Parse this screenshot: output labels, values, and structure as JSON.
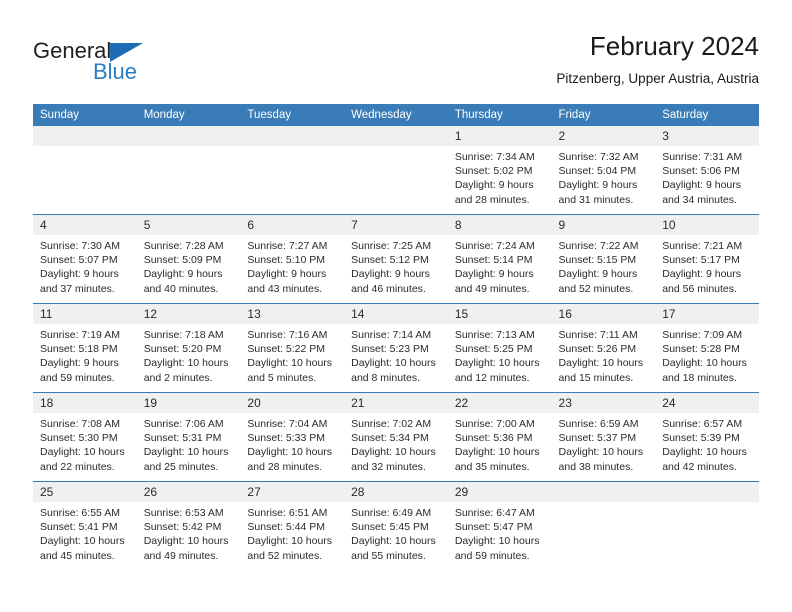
{
  "brand": {
    "line1": "General",
    "line2": "Blue",
    "triangle_color": "#1e6cb5",
    "blue_color": "#2b7dc4"
  },
  "header": {
    "title": "February 2024",
    "location": "Pitzenberg, Upper Austria, Austria"
  },
  "colors": {
    "header_blue": "#3a7cb8",
    "daynum_band": "#f0f0f0",
    "text": "#2b2b2b"
  },
  "weekday_headers": [
    "Sunday",
    "Monday",
    "Tuesday",
    "Wednesday",
    "Thursday",
    "Friday",
    "Saturday"
  ],
  "weeks": [
    [
      {
        "day": "",
        "empty": true
      },
      {
        "day": "",
        "empty": true
      },
      {
        "day": "",
        "empty": true
      },
      {
        "day": "",
        "empty": true
      },
      {
        "day": "1",
        "sunrise": "Sunrise: 7:34 AM",
        "sunset": "Sunset: 5:02 PM",
        "daylight1": "Daylight: 9 hours",
        "daylight2": "and 28 minutes."
      },
      {
        "day": "2",
        "sunrise": "Sunrise: 7:32 AM",
        "sunset": "Sunset: 5:04 PM",
        "daylight1": "Daylight: 9 hours",
        "daylight2": "and 31 minutes."
      },
      {
        "day": "3",
        "sunrise": "Sunrise: 7:31 AM",
        "sunset": "Sunset: 5:06 PM",
        "daylight1": "Daylight: 9 hours",
        "daylight2": "and 34 minutes."
      }
    ],
    [
      {
        "day": "4",
        "sunrise": "Sunrise: 7:30 AM",
        "sunset": "Sunset: 5:07 PM",
        "daylight1": "Daylight: 9 hours",
        "daylight2": "and 37 minutes."
      },
      {
        "day": "5",
        "sunrise": "Sunrise: 7:28 AM",
        "sunset": "Sunset: 5:09 PM",
        "daylight1": "Daylight: 9 hours",
        "daylight2": "and 40 minutes."
      },
      {
        "day": "6",
        "sunrise": "Sunrise: 7:27 AM",
        "sunset": "Sunset: 5:10 PM",
        "daylight1": "Daylight: 9 hours",
        "daylight2": "and 43 minutes."
      },
      {
        "day": "7",
        "sunrise": "Sunrise: 7:25 AM",
        "sunset": "Sunset: 5:12 PM",
        "daylight1": "Daylight: 9 hours",
        "daylight2": "and 46 minutes."
      },
      {
        "day": "8",
        "sunrise": "Sunrise: 7:24 AM",
        "sunset": "Sunset: 5:14 PM",
        "daylight1": "Daylight: 9 hours",
        "daylight2": "and 49 minutes."
      },
      {
        "day": "9",
        "sunrise": "Sunrise: 7:22 AM",
        "sunset": "Sunset: 5:15 PM",
        "daylight1": "Daylight: 9 hours",
        "daylight2": "and 52 minutes."
      },
      {
        "day": "10",
        "sunrise": "Sunrise: 7:21 AM",
        "sunset": "Sunset: 5:17 PM",
        "daylight1": "Daylight: 9 hours",
        "daylight2": "and 56 minutes."
      }
    ],
    [
      {
        "day": "11",
        "sunrise": "Sunrise: 7:19 AM",
        "sunset": "Sunset: 5:18 PM",
        "daylight1": "Daylight: 9 hours",
        "daylight2": "and 59 minutes."
      },
      {
        "day": "12",
        "sunrise": "Sunrise: 7:18 AM",
        "sunset": "Sunset: 5:20 PM",
        "daylight1": "Daylight: 10 hours",
        "daylight2": "and 2 minutes."
      },
      {
        "day": "13",
        "sunrise": "Sunrise: 7:16 AM",
        "sunset": "Sunset: 5:22 PM",
        "daylight1": "Daylight: 10 hours",
        "daylight2": "and 5 minutes."
      },
      {
        "day": "14",
        "sunrise": "Sunrise: 7:14 AM",
        "sunset": "Sunset: 5:23 PM",
        "daylight1": "Daylight: 10 hours",
        "daylight2": "and 8 minutes."
      },
      {
        "day": "15",
        "sunrise": "Sunrise: 7:13 AM",
        "sunset": "Sunset: 5:25 PM",
        "daylight1": "Daylight: 10 hours",
        "daylight2": "and 12 minutes."
      },
      {
        "day": "16",
        "sunrise": "Sunrise: 7:11 AM",
        "sunset": "Sunset: 5:26 PM",
        "daylight1": "Daylight: 10 hours",
        "daylight2": "and 15 minutes."
      },
      {
        "day": "17",
        "sunrise": "Sunrise: 7:09 AM",
        "sunset": "Sunset: 5:28 PM",
        "daylight1": "Daylight: 10 hours",
        "daylight2": "and 18 minutes."
      }
    ],
    [
      {
        "day": "18",
        "sunrise": "Sunrise: 7:08 AM",
        "sunset": "Sunset: 5:30 PM",
        "daylight1": "Daylight: 10 hours",
        "daylight2": "and 22 minutes."
      },
      {
        "day": "19",
        "sunrise": "Sunrise: 7:06 AM",
        "sunset": "Sunset: 5:31 PM",
        "daylight1": "Daylight: 10 hours",
        "daylight2": "and 25 minutes."
      },
      {
        "day": "20",
        "sunrise": "Sunrise: 7:04 AM",
        "sunset": "Sunset: 5:33 PM",
        "daylight1": "Daylight: 10 hours",
        "daylight2": "and 28 minutes."
      },
      {
        "day": "21",
        "sunrise": "Sunrise: 7:02 AM",
        "sunset": "Sunset: 5:34 PM",
        "daylight1": "Daylight: 10 hours",
        "daylight2": "and 32 minutes."
      },
      {
        "day": "22",
        "sunrise": "Sunrise: 7:00 AM",
        "sunset": "Sunset: 5:36 PM",
        "daylight1": "Daylight: 10 hours",
        "daylight2": "and 35 minutes."
      },
      {
        "day": "23",
        "sunrise": "Sunrise: 6:59 AM",
        "sunset": "Sunset: 5:37 PM",
        "daylight1": "Daylight: 10 hours",
        "daylight2": "and 38 minutes."
      },
      {
        "day": "24",
        "sunrise": "Sunrise: 6:57 AM",
        "sunset": "Sunset: 5:39 PM",
        "daylight1": "Daylight: 10 hours",
        "daylight2": "and 42 minutes."
      }
    ],
    [
      {
        "day": "25",
        "sunrise": "Sunrise: 6:55 AM",
        "sunset": "Sunset: 5:41 PM",
        "daylight1": "Daylight: 10 hours",
        "daylight2": "and 45 minutes."
      },
      {
        "day": "26",
        "sunrise": "Sunrise: 6:53 AM",
        "sunset": "Sunset: 5:42 PM",
        "daylight1": "Daylight: 10 hours",
        "daylight2": "and 49 minutes."
      },
      {
        "day": "27",
        "sunrise": "Sunrise: 6:51 AM",
        "sunset": "Sunset: 5:44 PM",
        "daylight1": "Daylight: 10 hours",
        "daylight2": "and 52 minutes."
      },
      {
        "day": "28",
        "sunrise": "Sunrise: 6:49 AM",
        "sunset": "Sunset: 5:45 PM",
        "daylight1": "Daylight: 10 hours",
        "daylight2": "and 55 minutes."
      },
      {
        "day": "29",
        "sunrise": "Sunrise: 6:47 AM",
        "sunset": "Sunset: 5:47 PM",
        "daylight1": "Daylight: 10 hours",
        "daylight2": "and 59 minutes."
      },
      {
        "day": "",
        "empty": true
      },
      {
        "day": "",
        "empty": true
      }
    ]
  ]
}
